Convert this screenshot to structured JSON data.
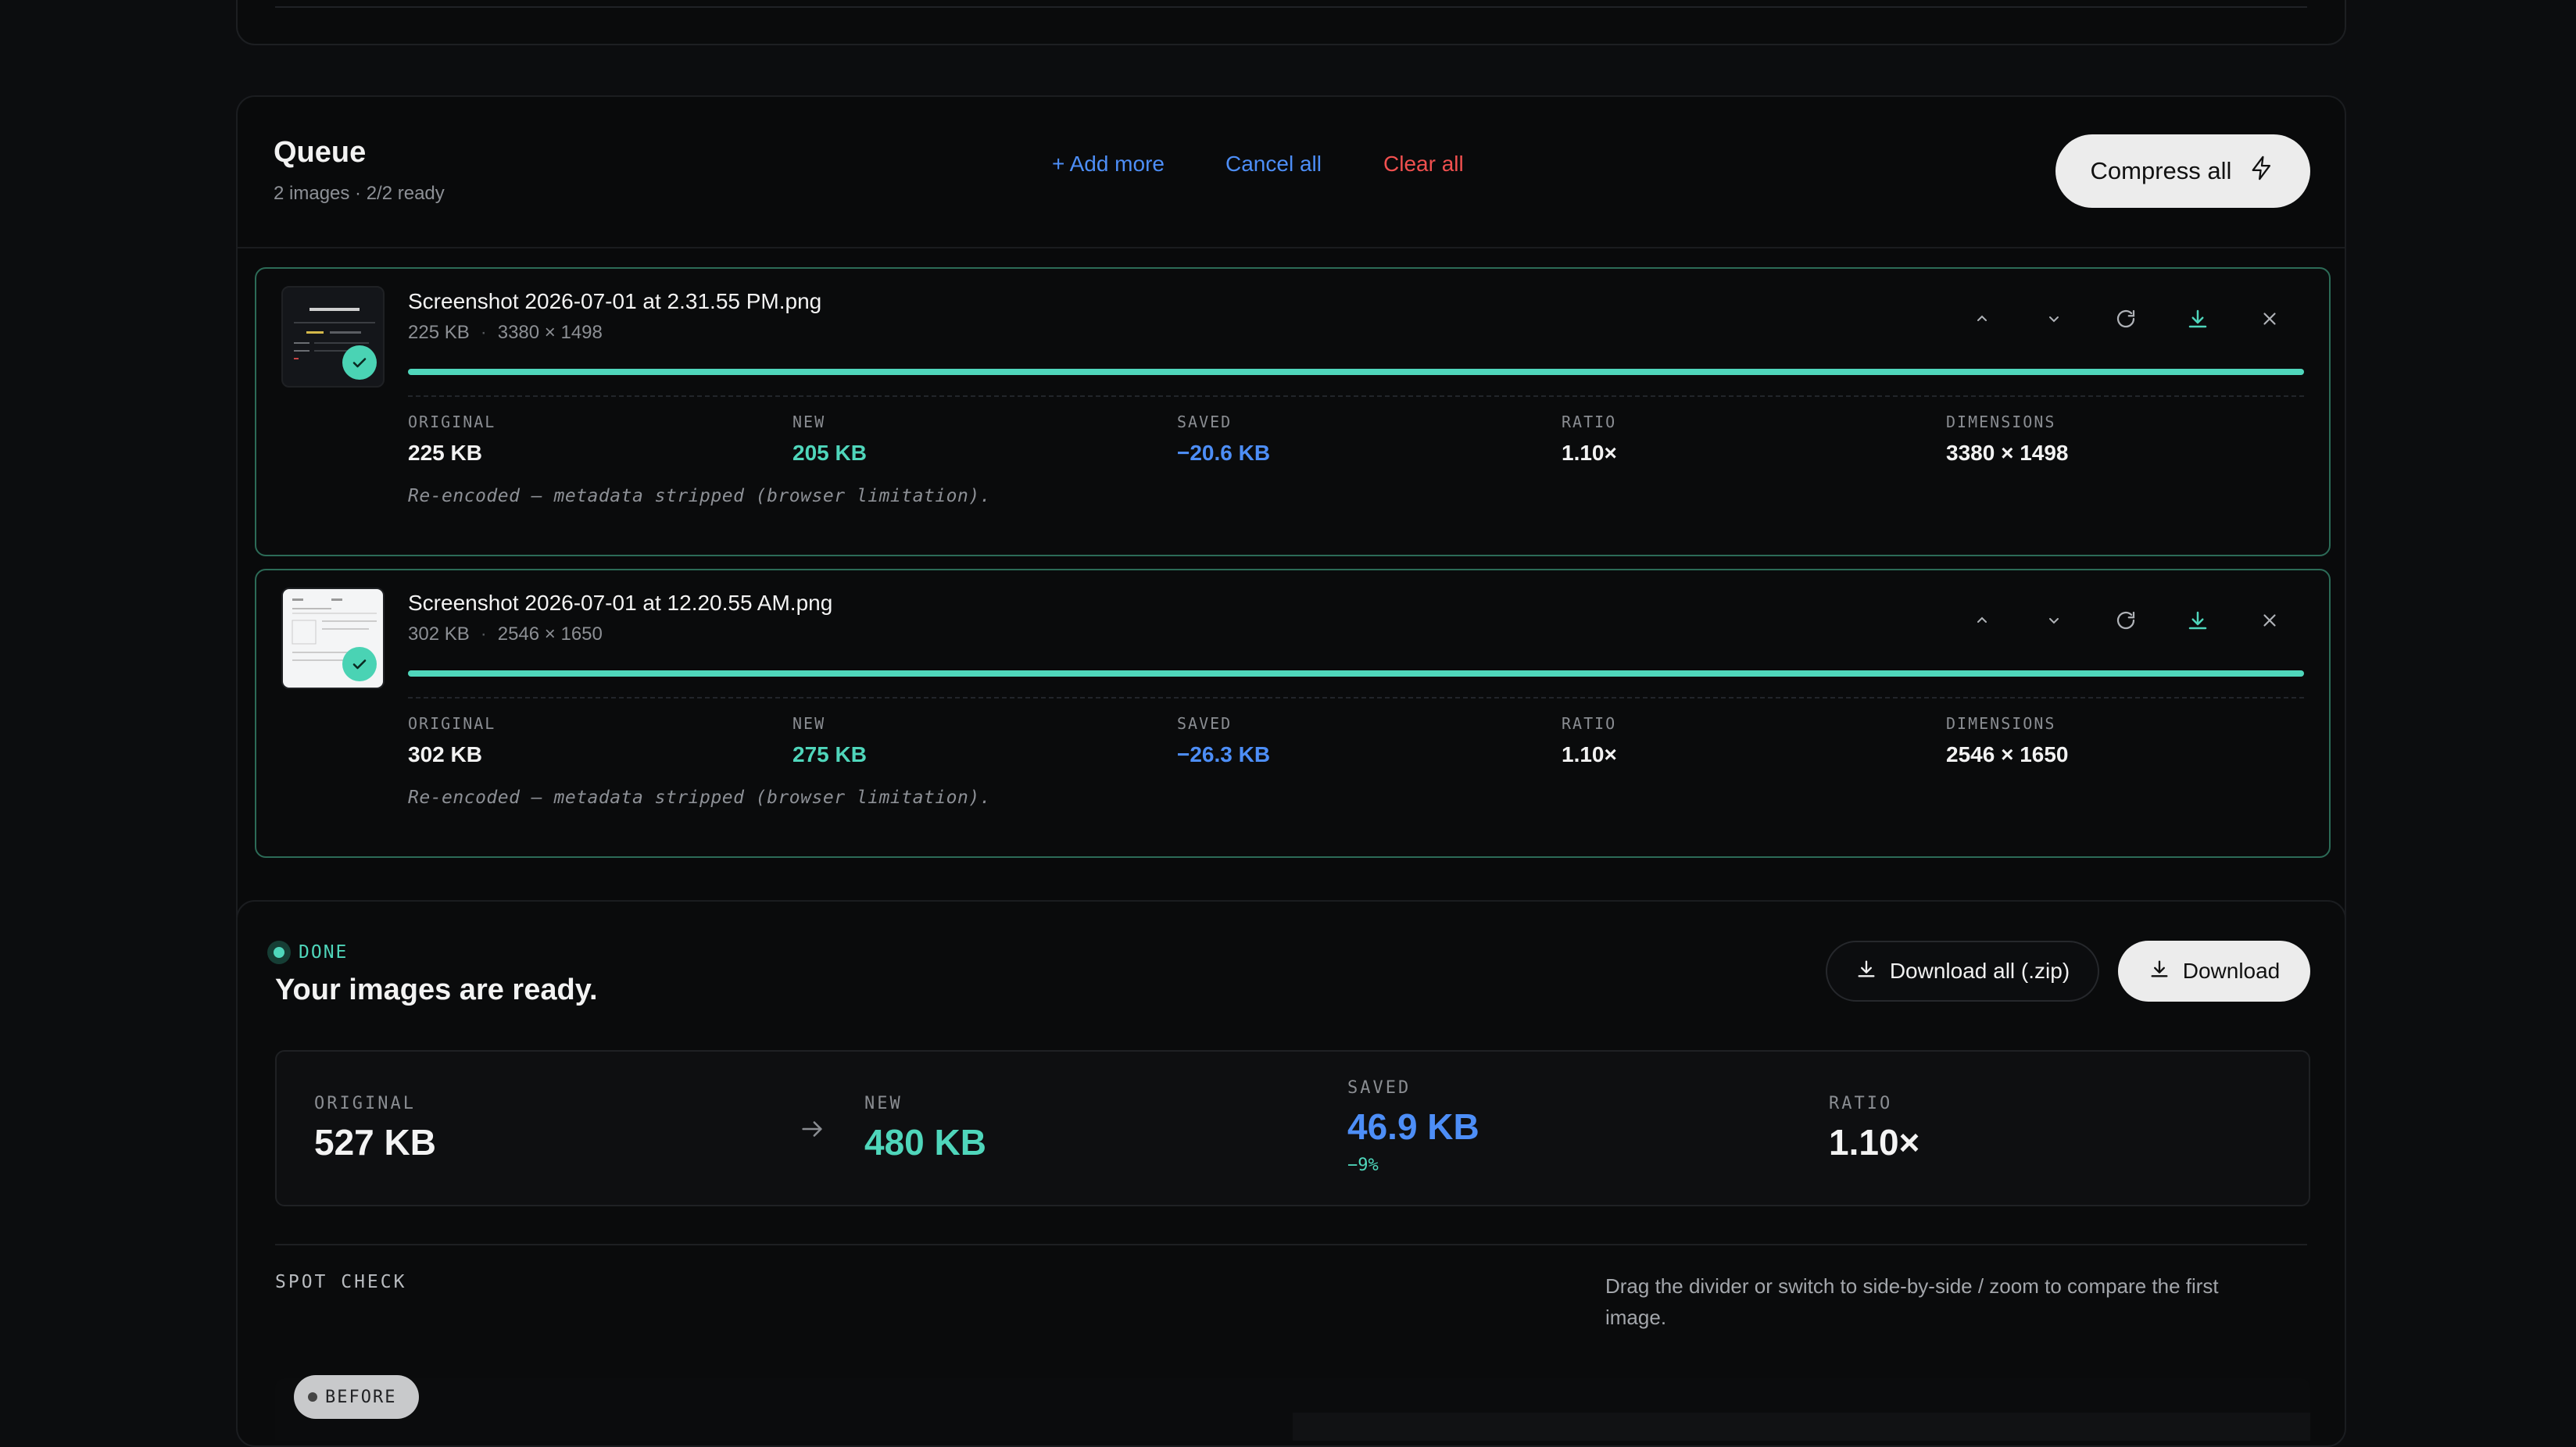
{
  "queue": {
    "title": "Queue",
    "subtitle": "2 images · 2/2 ready",
    "add_more": "+ Add more",
    "cancel_all": "Cancel all",
    "clear_all": "Clear all",
    "compress_all": "Compress all",
    "items": [
      {
        "filename": "Screenshot 2026-07-01 at 2.31.55 PM.png",
        "size": "225 KB",
        "dimensions": "3380 × 1498",
        "progress": 1.0,
        "stats": {
          "original_label": "ORIGINAL",
          "original": "225 KB",
          "new_label": "NEW",
          "new": "205 KB",
          "saved_label": "SAVED",
          "saved": "−20.6 KB",
          "ratio_label": "RATIO",
          "ratio": "1.10×",
          "dimensions_label": "DIMENSIONS",
          "dimensions": "3380 × 1498"
        },
        "note": "Re-encoded — metadata stripped (browser limitation)."
      },
      {
        "filename": "Screenshot 2026-07-01 at 12.20.55 AM.png",
        "size": "302 KB",
        "dimensions": "2546 × 1650",
        "progress": 1.0,
        "stats": {
          "original_label": "ORIGINAL",
          "original": "302 KB",
          "new_label": "NEW",
          "new": "275 KB",
          "saved_label": "SAVED",
          "saved": "−26.3 KB",
          "ratio_label": "RATIO",
          "ratio": "1.10×",
          "dimensions_label": "DIMENSIONS",
          "dimensions": "2546 × 1650"
        },
        "note": "Re-encoded — metadata stripped (browser limitation)."
      }
    ]
  },
  "done": {
    "badge": "DONE",
    "title": "Your images are ready.",
    "download_zip": "Download all (.zip)",
    "download": "Download",
    "summary": {
      "original_label": "ORIGINAL",
      "original": "527 KB",
      "new_label": "NEW",
      "new": "480 KB",
      "saved_label": "SAVED",
      "saved": "46.9 KB",
      "saved_pct": "−9%",
      "ratio_label": "RATIO",
      "ratio": "1.10×"
    },
    "spot_check_label": "SPOT CHECK",
    "spot_check_text": "Drag the divider or switch to side-by-side / zoom to compare the first image.",
    "before_label": "BEFORE"
  },
  "colors": {
    "accent_teal": "#4fd6bb",
    "accent_blue": "#4d8ef7",
    "danger_red": "#f0504f",
    "background": "#0c0d0f"
  }
}
